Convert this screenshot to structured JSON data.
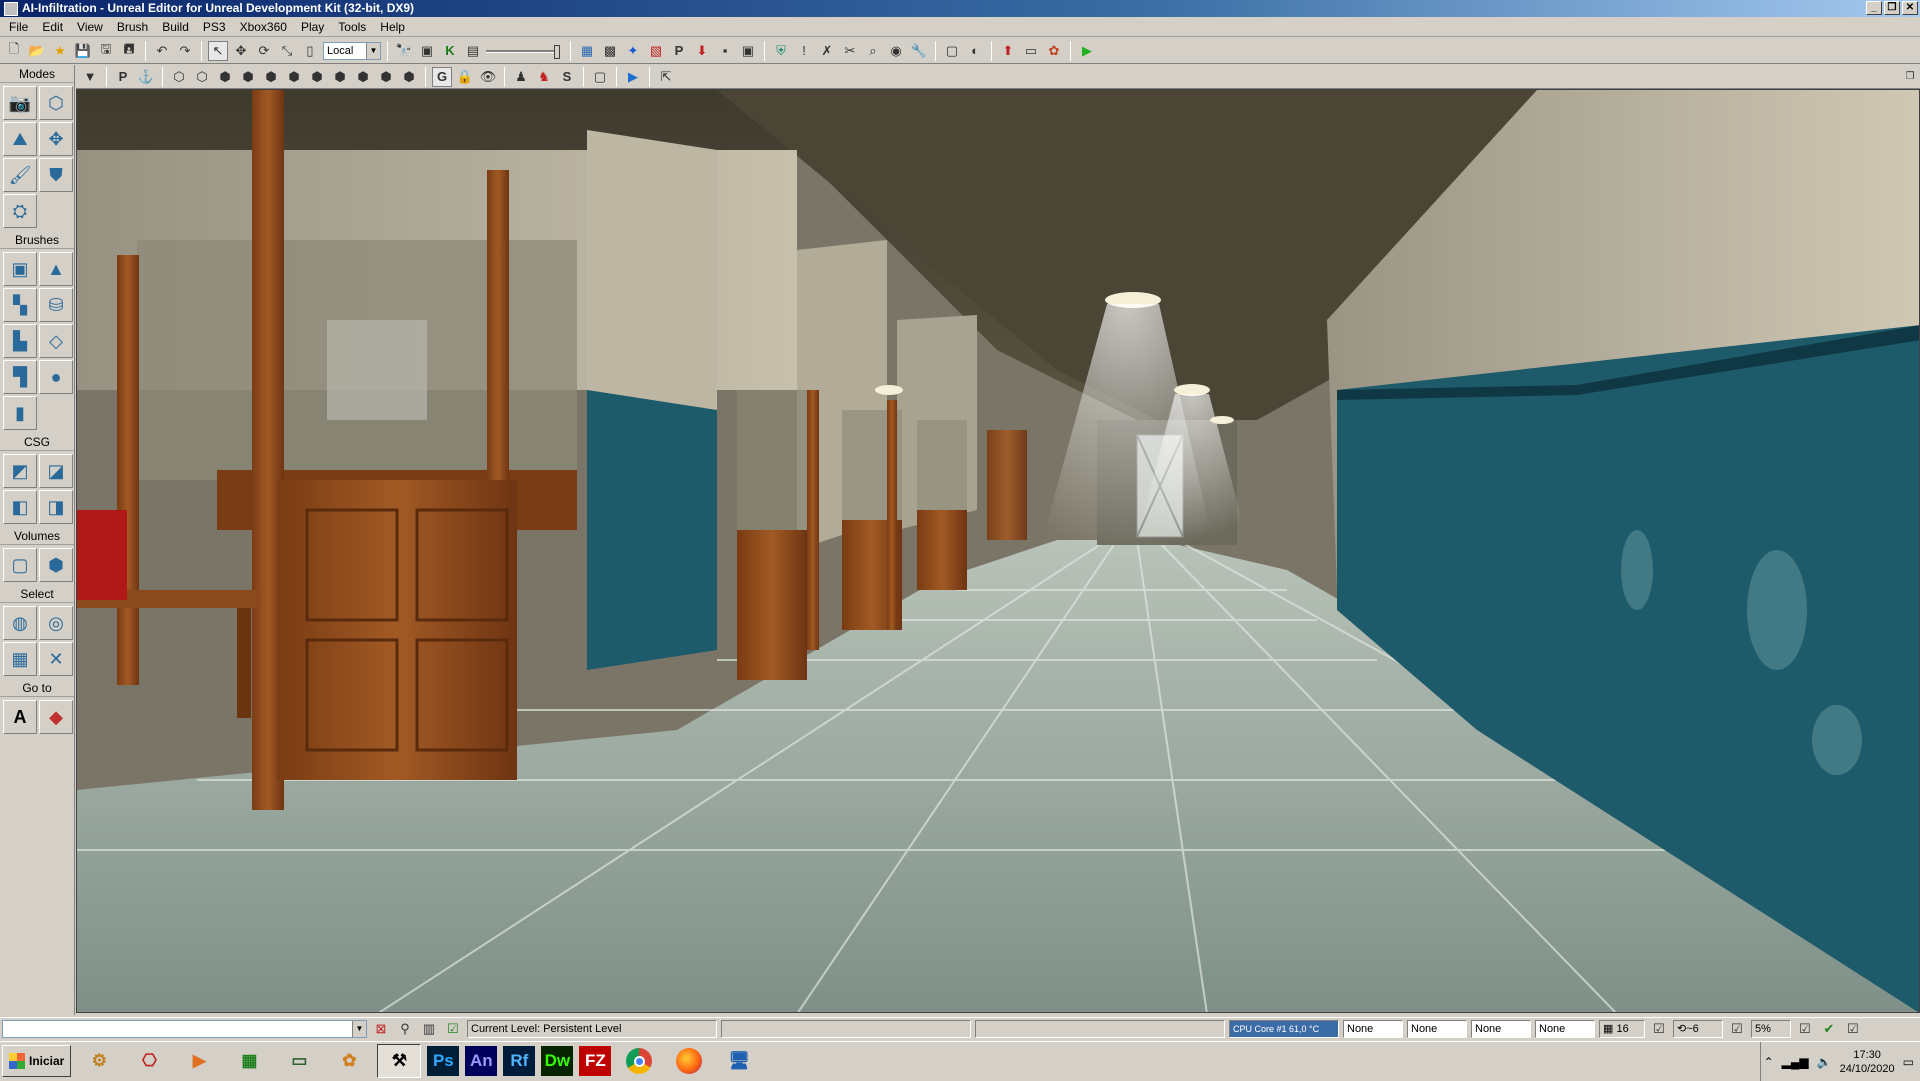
{
  "window": {
    "title": "AI-Infiltration - Unreal Editor for Unreal Development Kit (32-bit, DX9)"
  },
  "menu": [
    "File",
    "Edit",
    "View",
    "Brush",
    "Build",
    "PS3",
    "Xbox360",
    "Play",
    "Tools",
    "Help"
  ],
  "toolbar": {
    "coord_system": "Local"
  },
  "modes_panel": {
    "modes_label": "Modes",
    "brushes_label": "Brushes",
    "csg_label": "CSG",
    "volumes_label": "Volumes",
    "select_label": "Select",
    "goto_label": "Go to"
  },
  "viewport_toolbar": {
    "p_label": "P",
    "g_label": "G",
    "s_label": "S"
  },
  "statusbar": {
    "current_level_label": "Current Level:",
    "current_level_value": "Persistent Level",
    "cpu": "CPU Core #1   61,0 °C",
    "drag_grid_fields": [
      "None",
      "None",
      "None",
      "None"
    ],
    "grid_size": "16",
    "rotation_grid": "~6",
    "scale_grid": "5%"
  },
  "taskbar": {
    "start_label": "Iniciar",
    "apps": [
      {
        "label": "",
        "icon": "settings-icon"
      },
      {
        "label": "",
        "icon": "pdf-icon"
      },
      {
        "label": "",
        "icon": "media-icon"
      },
      {
        "label": "",
        "icon": "chart-app-icon"
      },
      {
        "label": "",
        "icon": "monitor-icon"
      },
      {
        "label": "",
        "icon": "network-icon"
      },
      {
        "label": "",
        "icon": "unreal-editor-icon"
      },
      {
        "label": "Ps",
        "icon": "photoshop-icon"
      },
      {
        "label": "An",
        "icon": "animate-icon"
      },
      {
        "label": "Rf",
        "icon": "reflow-icon"
      },
      {
        "label": "Dw",
        "icon": "dreamweaver-icon"
      },
      {
        "label": "FZ",
        "icon": "filezilla-icon"
      },
      {
        "label": "",
        "icon": "chrome-icon"
      },
      {
        "label": "",
        "icon": "firefox-icon"
      },
      {
        "label": "",
        "icon": "remote-desktop-icon"
      }
    ],
    "clock_time": "17:30",
    "clock_date": "24/10/2020"
  },
  "colors": {
    "title_gradient_start": "#0a246a",
    "ps": "#001e36",
    "ps_text": "#31a8ff",
    "an": "#00005b",
    "an_text": "#9999ff",
    "rf": "#001c3a",
    "rf_text": "#4fb3ff",
    "dw": "#072401",
    "dw_text": "#35fa00",
    "fz": "#bf0000"
  }
}
